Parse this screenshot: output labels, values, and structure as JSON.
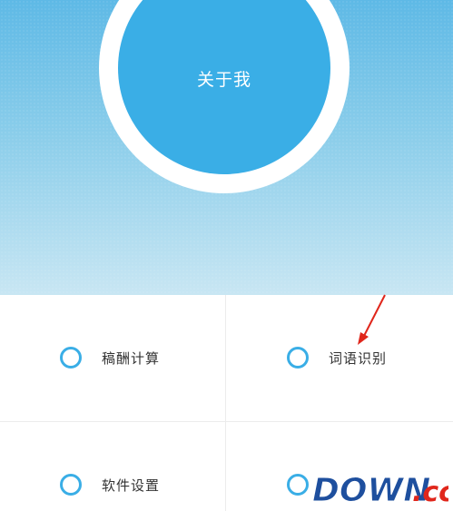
{
  "profile": {
    "label": "关于我"
  },
  "menu": {
    "items": [
      {
        "label": "稿酬计算"
      },
      {
        "label": "词语识别"
      },
      {
        "label": "软件设置"
      },
      {
        "label": ""
      }
    ]
  },
  "watermark": {
    "text_main": "DOWN",
    "text_suffix": ".cc"
  },
  "colors": {
    "accent": "#3aaee6",
    "hero_top": "#5eb9e6",
    "hero_bottom": "#c8e6f3",
    "annotation": "#e0261b"
  }
}
